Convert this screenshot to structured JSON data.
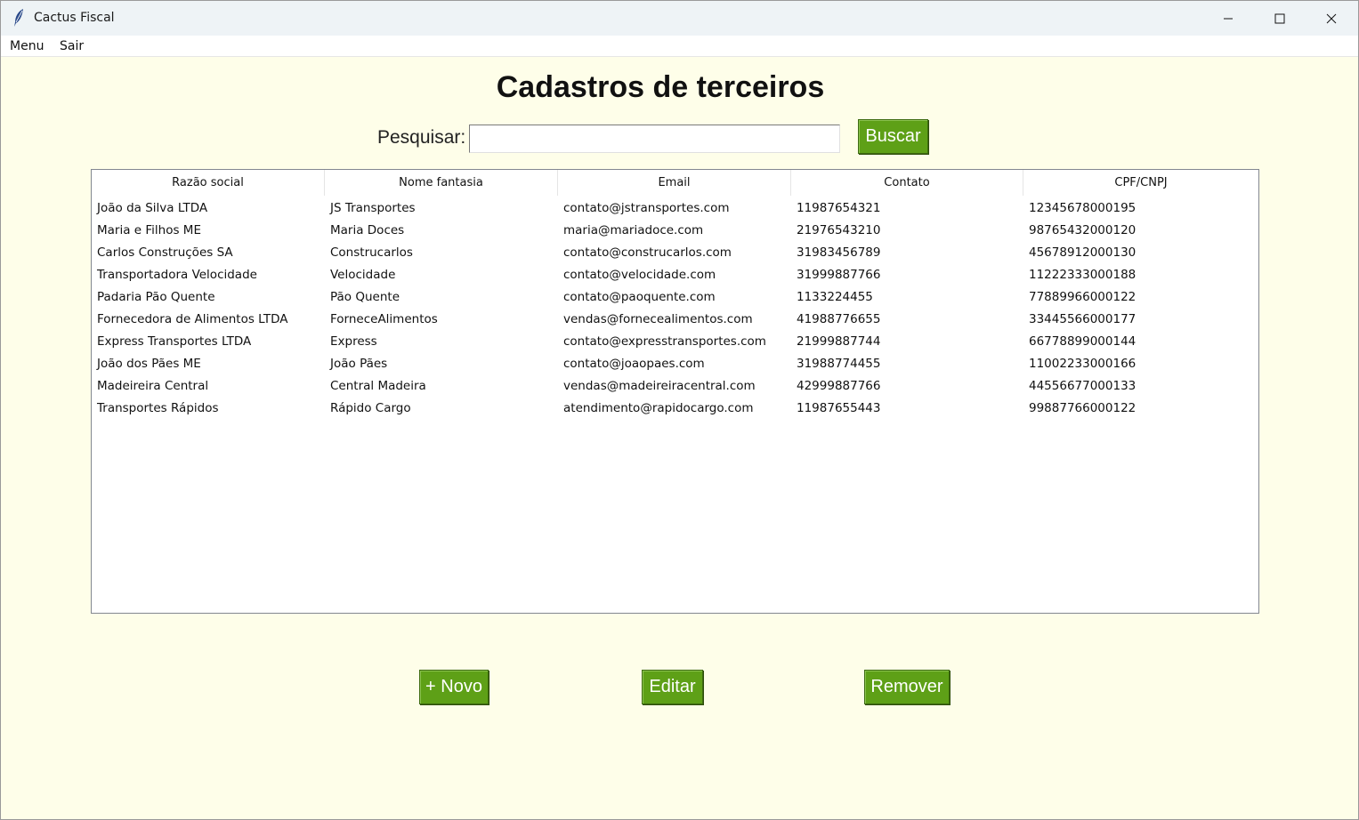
{
  "window": {
    "title": "Cactus Fiscal"
  },
  "menubar": {
    "menu": "Menu",
    "sair": "Sair"
  },
  "page": {
    "title": "Cadastros de terceiros"
  },
  "search": {
    "label": "Pesquisar:",
    "value": "",
    "button": "Buscar"
  },
  "table": {
    "columns": [
      "Razão social",
      "Nome fantasia",
      "Email",
      "Contato",
      "CPF/CNPJ"
    ],
    "rows": [
      [
        "João da Silva LTDA",
        "JS Transportes",
        "contato@jstransportes.com",
        "11987654321",
        "12345678000195"
      ],
      [
        "Maria e Filhos ME",
        "Maria Doces",
        "maria@mariadoce.com",
        "21976543210",
        "98765432000120"
      ],
      [
        "Carlos Construções SA",
        "Construcarlos",
        "contato@construcarlos.com",
        "31983456789",
        "45678912000130"
      ],
      [
        "Transportadora Velocidade",
        "Velocidade",
        "contato@velocidade.com",
        "31999887766",
        "11222333000188"
      ],
      [
        "Padaria Pão Quente",
        "Pão Quente",
        "contato@paoquente.com",
        "1133224455",
        "77889966000122"
      ],
      [
        "Fornecedora de Alimentos LTDA",
        "ForneceAlimentos",
        "vendas@fornecealimentos.com",
        "41988776655",
        "33445566000177"
      ],
      [
        "Express Transportes LTDA",
        "Express",
        "contato@expresstransportes.com",
        "21999887744",
        "66778899000144"
      ],
      [
        "João dos Pães ME",
        "João Pães",
        "contato@joaopaes.com",
        "31988774455",
        "11002233000166"
      ],
      [
        "Madeireira Central",
        "Central Madeira",
        "vendas@madeireiracentral.com",
        "42999887766",
        "44556677000133"
      ],
      [
        "Transportes Rápidos",
        "Rápido Cargo",
        "atendimento@rapidocargo.com",
        "11987655443",
        "99887766000122"
      ]
    ]
  },
  "actions": {
    "novo": "+ Novo",
    "editar": "Editar",
    "remover": "Remover"
  },
  "colors": {
    "accent": "#5ea017",
    "background": "#fefee9"
  }
}
